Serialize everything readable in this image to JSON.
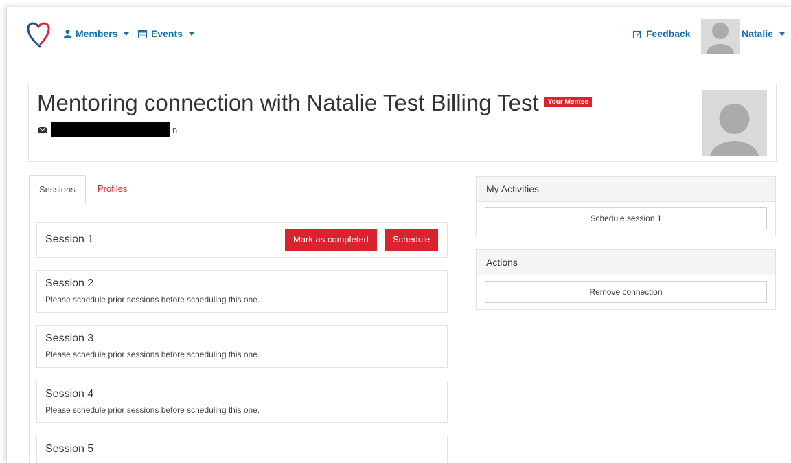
{
  "nav": {
    "members": "Members",
    "events": "Events",
    "feedback": "Feedback",
    "user": "Natalie"
  },
  "header": {
    "title": "Mentoring connection with Natalie Test Billing Test",
    "badge": "Your Mentee",
    "email_tail": "n"
  },
  "tabs": [
    {
      "label": "Sessions"
    },
    {
      "label": "Profiles"
    }
  ],
  "sessions": [
    {
      "title": "Session 1",
      "note": ""
    },
    {
      "title": "Session 2",
      "note": "Please schedule prior sessions before scheduling this one."
    },
    {
      "title": "Session 3",
      "note": "Please schedule prior sessions before scheduling this one."
    },
    {
      "title": "Session 4",
      "note": "Please schedule prior sessions before scheduling this one."
    },
    {
      "title": "Session 5",
      "note": ""
    }
  ],
  "session_actions": {
    "mark_completed": "Mark as completed",
    "schedule": "Schedule"
  },
  "my_activities": {
    "title": "My Activities",
    "button": "Schedule session 1"
  },
  "actions": {
    "title": "Actions",
    "button": "Remove connection"
  },
  "colors": {
    "brand_red": "#d9232e",
    "link_blue": "#1a6fa8",
    "placeholder_gray": "#dadada"
  },
  "icons": [
    "heart-logo-icon",
    "user-icon",
    "calendar-icon",
    "edit-icon",
    "envelope-icon",
    "avatar-icon"
  ]
}
